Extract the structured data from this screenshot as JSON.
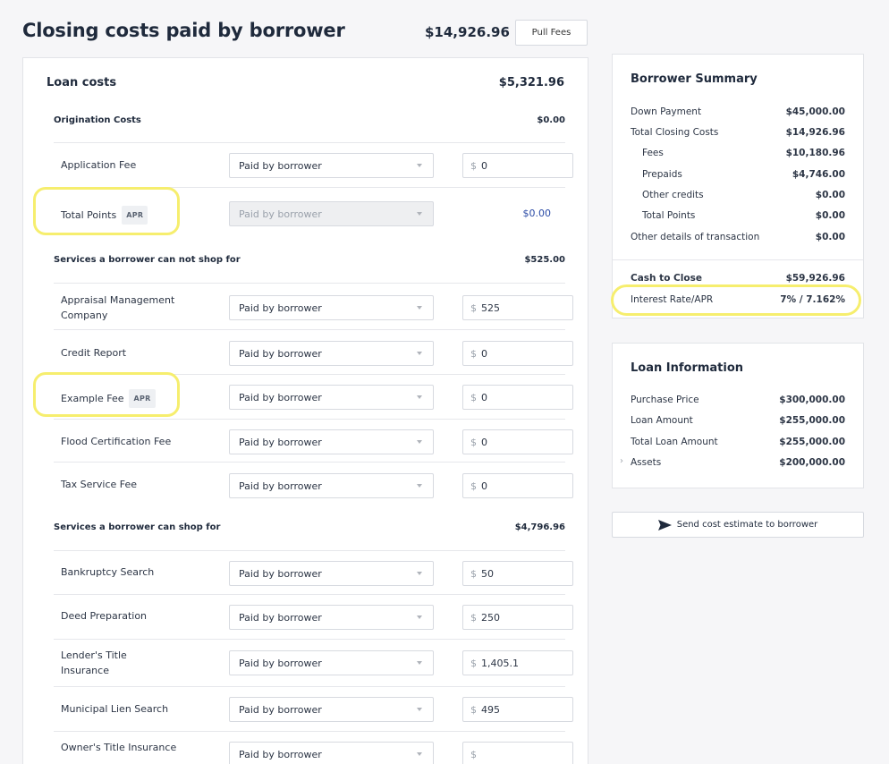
{
  "header": {
    "title": "Closing costs paid by borrower",
    "total": "$14,926.96",
    "pull_fees_label": "Pull Fees"
  },
  "loan_costs": {
    "title": "Loan costs",
    "total": "$5,321.96",
    "origination": {
      "title": "Origination Costs",
      "total": "$0.00",
      "rows": [
        {
          "label": "Application Fee",
          "paid_by": "Paid by borrower",
          "currency": "$",
          "amount": "0"
        },
        {
          "label": "Total Points",
          "badge": "APR",
          "paid_by": "Paid by borrower",
          "amount_text": "$0.00"
        }
      ]
    },
    "cannot_shop": {
      "title": "Services a borrower can not shop for",
      "total": "$525.00",
      "rows": [
        {
          "label": "Appraisal Management Company",
          "paid_by": "Paid by borrower",
          "currency": "$",
          "amount": "525"
        },
        {
          "label": "Credit Report",
          "paid_by": "Paid by borrower",
          "currency": "$",
          "amount": "0"
        },
        {
          "label": "Example Fee",
          "badge": "APR",
          "paid_by": "Paid by borrower",
          "currency": "$",
          "amount": "0"
        },
        {
          "label": "Flood Certification Fee",
          "paid_by": "Paid by borrower",
          "currency": "$",
          "amount": "0"
        },
        {
          "label": "Tax Service Fee",
          "paid_by": "Paid by borrower",
          "currency": "$",
          "amount": "0"
        }
      ]
    },
    "can_shop": {
      "title": "Services a borrower can shop for",
      "total": "$4,796.96",
      "rows": [
        {
          "label": "Bankruptcy Search",
          "paid_by": "Paid by borrower",
          "currency": "$",
          "amount": "50"
        },
        {
          "label": "Deed Preparation",
          "paid_by": "Paid by borrower",
          "currency": "$",
          "amount": "250"
        },
        {
          "label": "Lender's Title Insurance",
          "paid_by": "Paid by borrower",
          "currency": "$",
          "amount": "1,405.1"
        },
        {
          "label": "Municipal Lien Search",
          "paid_by": "Paid by borrower",
          "currency": "$",
          "amount": "495"
        },
        {
          "label": "Owner's Title Insurance",
          "paid_by": "Paid by borrower",
          "currency": "$",
          "amount": ""
        }
      ]
    }
  },
  "borrower_summary": {
    "title": "Borrower Summary",
    "items": [
      {
        "label": "Down Payment",
        "value": "$45,000.00"
      },
      {
        "label": "Total Closing Costs",
        "value": "$14,926.96"
      },
      {
        "label": "Fees",
        "value": "$10,180.96"
      },
      {
        "label": "Prepaids",
        "value": "$4,746.00"
      },
      {
        "label": "Other credits",
        "value": "$0.00"
      },
      {
        "label": "Total Points",
        "value": "$0.00"
      },
      {
        "label": "Other details of transaction",
        "value": "$0.00"
      }
    ],
    "cash_to_close": {
      "label": "Cash to Close",
      "value": "$59,926.96"
    },
    "interest_rate": {
      "label": "Interest Rate/APR",
      "value": "7% / 7.162%"
    }
  },
  "loan_information": {
    "title": "Loan Information",
    "items": [
      {
        "label": "Purchase Price",
        "value": "$300,000.00"
      },
      {
        "label": "Loan Amount",
        "value": "$255,000.00"
      },
      {
        "label": "Total Loan Amount",
        "value": "$255,000.00"
      },
      {
        "label": "Assets",
        "value": "$200,000.00"
      }
    ]
  },
  "send_button_label": "Send cost estimate to borrower",
  "icons": {
    "send": "send-icon",
    "caret": "chevron-down-icon",
    "expand": "chevron-right-icon"
  },
  "colors": {
    "highlight": "#f6ee6e",
    "link_amount": "#2b4ba6"
  }
}
